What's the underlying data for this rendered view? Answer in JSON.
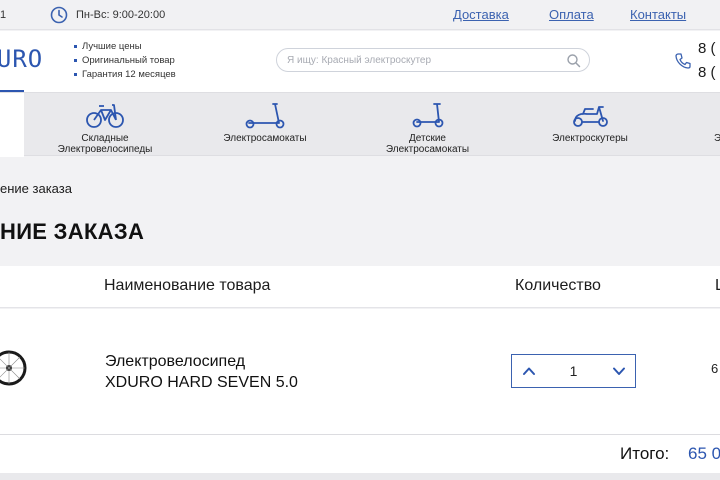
{
  "topbar": {
    "phone_fragment": "1",
    "hours": "Пн-Вс: 9:00-20:00",
    "links": [
      "Доставка",
      "Оплата",
      "Контакты"
    ]
  },
  "header": {
    "logo": "XDURO",
    "features": [
      "Лучшие цены",
      "Оригинальный товар",
      "Гарантия 12 месяцев"
    ],
    "search_placeholder": "Я ищу: Красный электроскутер",
    "phones": [
      "8 (",
      "8 ("
    ]
  },
  "nav": {
    "categories": [
      {
        "label": "Складные Электровелосипеды",
        "icon": "bike-icon"
      },
      {
        "label": "Электросамокаты",
        "icon": "scooter-icon"
      },
      {
        "label": "Детские Электросамокаты",
        "icon": "kids-scooter-icon"
      },
      {
        "label": "Электроскутеры",
        "icon": "moped-icon"
      },
      {
        "label": "Э",
        "icon": ""
      }
    ]
  },
  "breadcrumb": "ение заказа",
  "page_title": "НИЕ ЗАКАЗА",
  "table": {
    "headers": [
      "Наименование товара",
      "Количество",
      "Ц"
    ],
    "rows": [
      {
        "name_line1": "Электровелосипед",
        "name_line2": "XDURO HARD SEVEN 5.0",
        "quantity": "1",
        "price": "6"
      }
    ]
  },
  "total": {
    "label": "Итого:",
    "value": "65 0"
  },
  "colors": {
    "accent": "#2c56b0",
    "link": "#3b62b0",
    "nav_bg": "#e9e9ec",
    "page_bg": "#f2f2f4"
  }
}
